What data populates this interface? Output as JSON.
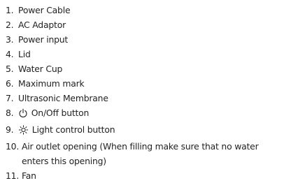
{
  "parts_list": {
    "items": [
      {
        "number": "1.",
        "label": "Power Cable"
      },
      {
        "number": "2.",
        "label": "AC Adaptor"
      },
      {
        "number": "3.",
        "label": "Power input"
      },
      {
        "number": "4.",
        "label": "Lid"
      },
      {
        "number": "5.",
        "label": "Water Cup"
      },
      {
        "number": "6.",
        "label": "Maximum mark"
      },
      {
        "number": "7.",
        "label": "Ultrasonic Membrane"
      },
      {
        "number": "8.",
        "label": "On/Off button",
        "icon": "power-icon"
      },
      {
        "number": "9.",
        "label": "Light control button",
        "icon": "light-icon"
      },
      {
        "number": "10.",
        "label_line1": "Air outlet opening (When filling make sure that no water",
        "label_line2": "enters this opening)"
      },
      {
        "number": "11.",
        "label": "Fan"
      }
    ]
  }
}
